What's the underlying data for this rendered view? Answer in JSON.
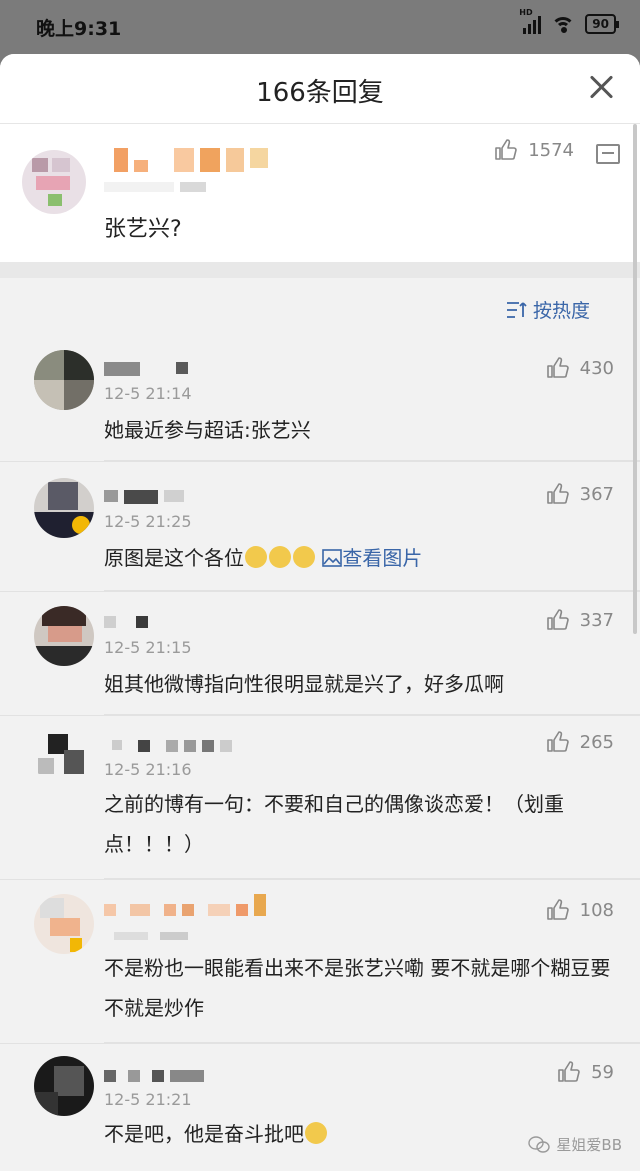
{
  "status": {
    "time": "晚上9:31",
    "network": "HD",
    "battery": "90"
  },
  "header": {
    "title": "166条回复"
  },
  "main_comment": {
    "likes": "1574",
    "text": "张艺兴?"
  },
  "sort": {
    "label": "按热度"
  },
  "comments": [
    {
      "time": "12-5 21:14",
      "likes": "430",
      "text": "她最近参与超话:张艺兴"
    },
    {
      "time": "12-5 21:25",
      "likes": "367",
      "text": "原图是这个各位",
      "link": "查看图片"
    },
    {
      "time": "12-5 21:15",
      "likes": "337",
      "text": "姐其他微博指向性很明显就是兴了，好多瓜啊"
    },
    {
      "time": "12-5 21:16",
      "likes": "265",
      "text": "之前的博有一句：不要和自己的偶像谈恋爱！（划重点！！！）"
    },
    {
      "time": "",
      "likes": "108",
      "text": "不是粉也一眼能看出来不是张艺兴嘞 要不就是哪个糊豆要不就是炒作"
    },
    {
      "time": "12-5 21:21",
      "likes": "59",
      "text": "不是吧，他是奋斗批吧"
    }
  ],
  "watermark": "星姐爱BB",
  "icons": {
    "like": "thumb-up-icon",
    "reply": "comment-icon",
    "sort": "sort-icon",
    "close": "close-icon",
    "image": "image-icon"
  }
}
